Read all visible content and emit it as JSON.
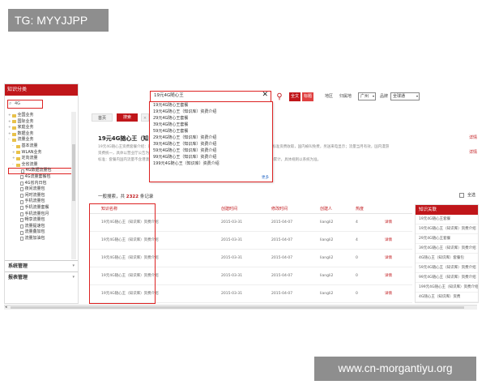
{
  "overlay": {
    "top_left": "TG: MYYJJPP",
    "bottom_right": "www.cn-morgantiyu.org"
  },
  "sidebar": {
    "title": "知识分类",
    "search_value": "4G",
    "tree": [
      {
        "label": "全国业务",
        "kind": "folder",
        "tw": "+",
        "indent": 1
      },
      {
        "label": "国际业务",
        "kind": "folder",
        "tw": "+",
        "indent": 1
      },
      {
        "label": "家庭业务",
        "kind": "folder",
        "tw": "+",
        "indent": 1
      },
      {
        "label": "数据业务",
        "kind": "folder",
        "tw": "+",
        "indent": 1
      },
      {
        "label": "流量业务",
        "kind": "folder",
        "tw": "-",
        "indent": 1
      },
      {
        "label": "基本流量",
        "kind": "folder",
        "tw": "-",
        "indent": 2
      },
      {
        "label": "WLAN业务",
        "kind": "folder",
        "tw": "+",
        "indent": 2
      },
      {
        "label": "定向流量",
        "kind": "folder",
        "tw": "+",
        "indent": 2
      },
      {
        "label": "全省流量",
        "kind": "folder",
        "tw": "-",
        "indent": 2
      },
      {
        "label": "4G数据流量包",
        "kind": "leaf",
        "tw": "",
        "indent": 3,
        "selected": true
      },
      {
        "label": "4G流量套餐包",
        "kind": "leaf",
        "tw": "",
        "indent": 3
      },
      {
        "label": "4G省内日包",
        "kind": "leaf",
        "tw": "",
        "indent": 3
      },
      {
        "label": "夜间流量包",
        "kind": "leaf",
        "tw": "",
        "indent": 3
      },
      {
        "label": "闲时流量包",
        "kind": "leaf",
        "tw": "",
        "indent": 3
      },
      {
        "label": "手机流量包",
        "kind": "leaf",
        "tw": "",
        "indent": 3
      },
      {
        "label": "手机流量套餐",
        "kind": "leaf",
        "tw": "",
        "indent": 3
      },
      {
        "label": "手机流量包月",
        "kind": "leaf",
        "tw": "",
        "indent": 3
      },
      {
        "label": "畅享流量包",
        "kind": "leaf",
        "tw": "",
        "indent": 3
      },
      {
        "label": "流量提速包",
        "kind": "leaf",
        "tw": "",
        "indent": 3
      },
      {
        "label": "流量叠加包",
        "kind": "leaf",
        "tw": "",
        "indent": 3
      },
      {
        "label": "流量加油包",
        "kind": "leaf",
        "tw": "",
        "indent": 3
      }
    ],
    "sections": [
      "系统管理",
      "报表管理"
    ]
  },
  "search": {
    "value": "19元4G随心王",
    "btn_full": "全文",
    "btn_part": "标题",
    "suggestions": [
      "19元4G随心王套餐",
      "19元4G随心王（知识库）资费介绍",
      "29元4G随心王套餐",
      "39元4G随心王套餐",
      "59元4G随心王套餐",
      "29元4G随心王（知识库）资费介绍",
      "39元4G随心王（知识库）资费介绍",
      "59元4G随心王（知识库）资费介绍",
      "99元4G随心王（知识库）资费介绍",
      "199元4G随心王（知识库）资费介绍"
    ],
    "more": "更多"
  },
  "filters": {
    "region_label": "地区",
    "province_label": "归属地",
    "province_value": "广州",
    "brand_label": "品牌",
    "brand_value": "全球通"
  },
  "tabs": {
    "home": "首页",
    "active": "搜索"
  },
  "detail": {
    "title": "19元4G随心王（知",
    "body_1": "19元4G随心王资费套餐介绍：月功能费19元，含国内主叫通话50分钟，国内流量1GB（省内），超出部分按标准资费收取，国内被叫免费，另送来电显示；流量当月有效，国内漫游资费统一，具体以营业厅公告为准。",
    "body_2": "标准：套餐内国内流量不含港澳台，流量超出后按0.29元/MB计费，封顶60元/月，达到封顶后按1元/100MB累计，具体规则以系统为准。",
    "link_1": "详情",
    "link_2": "详情"
  },
  "results": {
    "prefix": "一般搜索，共",
    "count": "2322",
    "suffix": "条记录",
    "select_all": "全选",
    "columns": [
      "知识名称",
      "创建时间",
      "修改时间",
      "创建人",
      "热度",
      ""
    ],
    "rows": [
      {
        "name": "19元4G随心王（知识库）资费介绍",
        "created": "2015-03-31",
        "modified": "2015-04-07",
        "creator": "liangli2",
        "heat": "4",
        "action": "详情"
      },
      {
        "name": "19元4G随心王（知识库）资费介绍",
        "created": "2015-03-31",
        "modified": "2015-04-07",
        "creator": "liangli2",
        "heat": "4",
        "action": "详情"
      },
      {
        "name": "19元4G随心王（知识库）资费介绍",
        "created": "2015-03-31",
        "modified": "2015-04-07",
        "creator": "liangli2",
        "heat": "0",
        "action": "详情"
      },
      {
        "name": "19元4G随心王（知识库）资费介绍",
        "created": "2015-03-31",
        "modified": "2015-04-07",
        "creator": "liangli2",
        "heat": "0",
        "action": "详情"
      },
      {
        "name": "19元4G随心王（知识库）资费介绍",
        "created": "2015-03-31",
        "modified": "2015-04-07",
        "creator": "liangli2",
        "heat": "0",
        "action": "详情"
      }
    ]
  },
  "related": {
    "title": "知识关联",
    "items": [
      "19元4G随心王套餐",
      "19元4G随心王（知识库）资费介绍",
      "29元4G随心王套餐",
      "39元4G随心王（知识库）资费介绍",
      "4G随心王（知识库）套餐包",
      "59元4G随心王（知识库）资费介绍",
      "99元4G随心王（知识库）资费介绍",
      "199元4G随心王（知识库）资费介绍",
      "4G随心王（知识库）资费"
    ]
  },
  "colors": {
    "brand": "#c0161a",
    "highlight": "#dd2222",
    "link": "#2a6bc7"
  }
}
